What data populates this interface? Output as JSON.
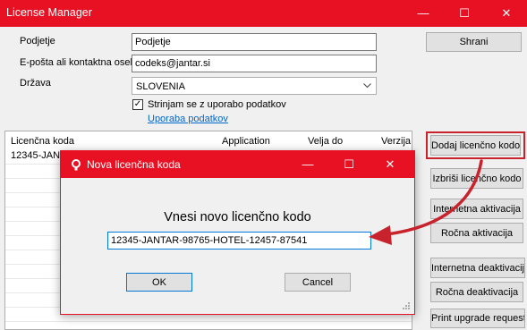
{
  "window": {
    "title": "License Manager",
    "minimize": "—",
    "maximize": "☐",
    "close": "✕"
  },
  "form": {
    "company_label": "Podjetje",
    "company_value": "Podjetje",
    "email_label": "E-pošta ali kontaktna oseba",
    "email_value": "codeks@jantar.si",
    "country_label": "Država",
    "country_value": "SLOVENIA",
    "consent_label": "Strinjam se z uporabo podatkov",
    "consent_checked": "✓",
    "usage_link": "Uporaba podatkov",
    "save_button": "Shrani"
  },
  "table": {
    "columns": [
      "Licenčna koda",
      "Application",
      "Velja do",
      "Verzija"
    ],
    "rows": [
      {
        "code": "12345-JANT",
        "application": "",
        "valid_until": "",
        "version": ""
      }
    ]
  },
  "actions": {
    "add": "Dodaj licenčno kodo",
    "delete": "Izbriši licenčno kodo",
    "internet_activation": "Internetna aktivacija",
    "manual_activation": "Ročna aktivacija",
    "internet_deactivation": "Internetna deaktivacija",
    "manual_deactivation": "Ročna deaktivacija",
    "print_upgrade": "Print upgrade request"
  },
  "dialog": {
    "title": "Nova licenčna koda",
    "prompt": "Vnesi novo licenčno kodo",
    "value": "12345-JANTAR-98765-HOTEL-12457-87541",
    "ok": "OK",
    "cancel": "Cancel"
  },
  "colors": {
    "accent": "#e81123",
    "highlight": "#c8232c",
    "link": "#0066cc"
  }
}
